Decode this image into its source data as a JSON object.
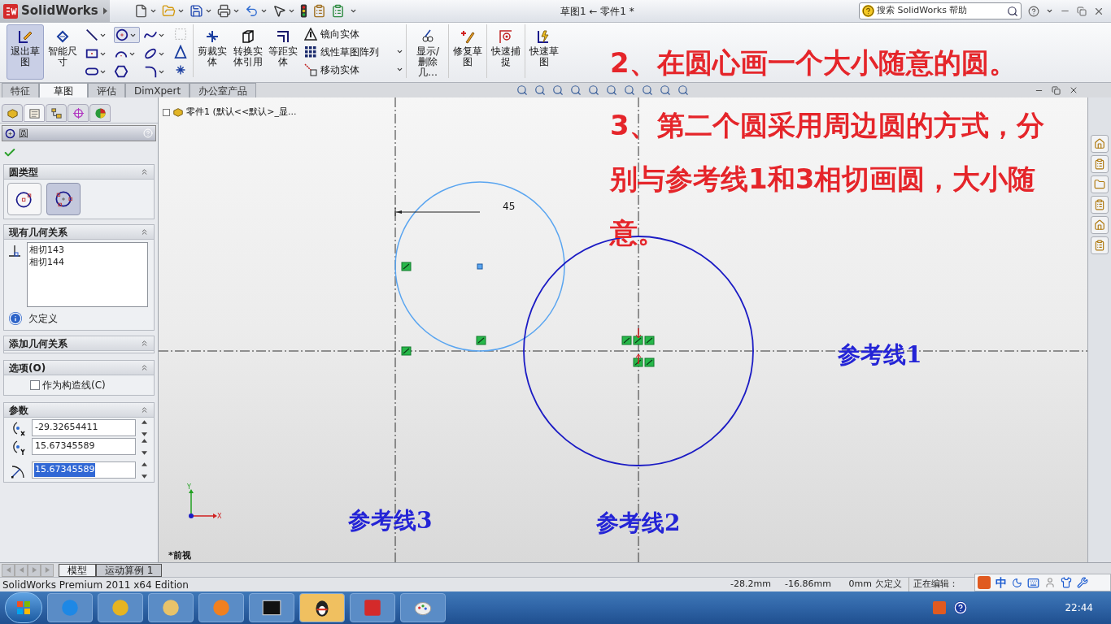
{
  "titlebar": {
    "logo": "SolidWorks",
    "document_title": "草图1 ← 零件1 *",
    "search": {
      "placeholder": "搜索 SolidWorks 帮助"
    }
  },
  "ribbon": {
    "exit_sketch": {
      "label": "退出草图",
      "selected": true
    },
    "smart_dimension": "智能尺寸",
    "commands": [
      "剪裁实体",
      "转换实体引用",
      "等距实体"
    ],
    "list_commands": [
      "镜向实体",
      "线性草图阵列",
      "移动实体"
    ],
    "tail_commands": [
      "显示/删除几…",
      "修复草图",
      "快速捕捉",
      "快速草图"
    ]
  },
  "tabs": [
    {
      "label": "特征",
      "selected": false
    },
    {
      "label": "草图",
      "selected": true
    },
    {
      "label": "评估",
      "selected": false
    },
    {
      "label": "DimXpert",
      "selected": false
    },
    {
      "label": "办公室产品",
      "selected": false
    }
  ],
  "panel": {
    "title": "圆",
    "tabs": [
      {
        "selected": false
      },
      {
        "selected": true
      },
      {
        "selected": false
      },
      {
        "selected": false
      },
      {
        "selected": false
      }
    ],
    "circle_type": {
      "title": "圆类型",
      "options": [
        {
          "kind": "center",
          "selected": false
        },
        {
          "kind": "perimeter",
          "selected": true
        }
      ]
    },
    "existing_relations": {
      "title": "现有几何关系",
      "items": [
        "相切143",
        "相切144"
      ],
      "status": "欠定义"
    },
    "add_relations": {
      "title": "添加几何关系"
    },
    "options": {
      "title": "选项(O)",
      "construction": {
        "label": "作为构造线(C)",
        "checked": false
      }
    },
    "parameters": {
      "title": "参数",
      "fields": [
        {
          "kind": "x",
          "value": "-29.32654411",
          "selected": false
        },
        {
          "kind": "y",
          "value": "15.67345589",
          "selected": false
        },
        {
          "kind": "radius",
          "value": "15.67345589",
          "selected": true
        }
      ]
    }
  },
  "canvas": {
    "tree_item": "零件1 (默认<<默认>_显...",
    "dimension": "45",
    "reference_lines": [
      "参考线1",
      "参考线3",
      "参考线2"
    ],
    "triad": {
      "y": "Y",
      "x": "X"
    },
    "view_label": "*前视"
  },
  "bottom_tabs": [
    {
      "label": "模型",
      "selected": true
    },
    {
      "label": "运动算例 1",
      "selected": false
    }
  ],
  "status_bar": {
    "edition": "SolidWorks Premium 2011 x64 Edition",
    "readouts": [
      "-28.2mm",
      "-16.86mm",
      "0mm"
    ],
    "state": "欠定义",
    "editing": "正在编辑："
  },
  "ime": {
    "mode": "中"
  },
  "taskbar": {
    "time": "22:44"
  },
  "annotations": [
    "2、在圆心画一个大小随意的圆。",
    "3、第二个圆采用周边圆的方式，分别与参考线1和3相切画圆，大小随意。"
  ]
}
